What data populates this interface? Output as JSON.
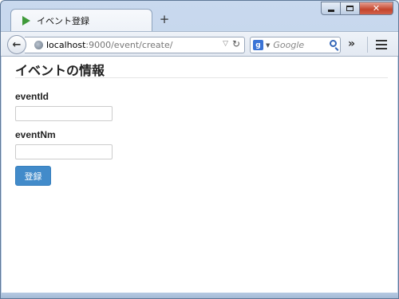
{
  "browser": {
    "tab_title": "イベント登録",
    "new_tab_label": "+",
    "url_host": "localhost",
    "url_path": ":9000/event/create/",
    "search_placeholder": "Google",
    "search_engine_letter": "g",
    "overflow_label": "»"
  },
  "window_controls": {
    "close_label": "✕"
  },
  "page": {
    "title": "イベントの情報",
    "fields": [
      {
        "label": "eventId",
        "value": ""
      },
      {
        "label": "eventNm",
        "value": ""
      }
    ],
    "submit_label": "登録"
  },
  "colors": {
    "primary_button": "#428bca",
    "tab_favicon": "#3f9a3a"
  }
}
